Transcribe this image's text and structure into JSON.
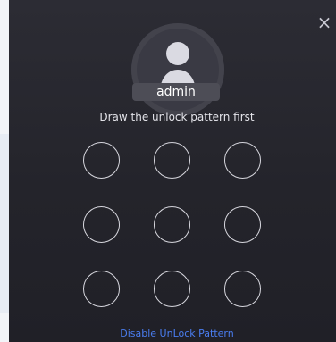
{
  "dialog": {
    "close_symbol": "×",
    "user": {
      "name": "admin",
      "avatar_icon": "user-avatar-icon"
    },
    "prompt": "Draw the unlock pattern first",
    "pattern_dots": [
      {
        "id": "1"
      },
      {
        "id": "2"
      },
      {
        "id": "3"
      },
      {
        "id": "4"
      },
      {
        "id": "5"
      },
      {
        "id": "6"
      },
      {
        "id": "7"
      },
      {
        "id": "8"
      },
      {
        "id": "9"
      }
    ],
    "disable_link": "Disable UnLock Pattern"
  },
  "colors": {
    "dialog_bg": "#24242b",
    "dot_stroke": "#d7d7de",
    "link": "#4a7df0"
  }
}
